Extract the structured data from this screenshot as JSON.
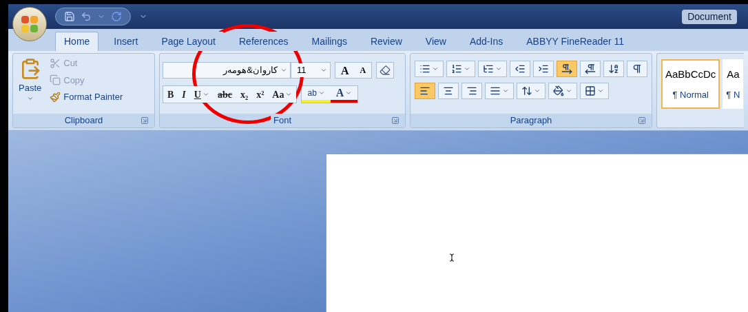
{
  "title_bar": {
    "title": "Document"
  },
  "tabs": [
    {
      "label": "Home",
      "selected": true
    },
    {
      "label": "Insert",
      "selected": false
    },
    {
      "label": "Page Layout",
      "selected": false
    },
    {
      "label": "References",
      "selected": false
    },
    {
      "label": "Mailings",
      "selected": false
    },
    {
      "label": "Review",
      "selected": false
    },
    {
      "label": "View",
      "selected": false
    },
    {
      "label": "Add-Ins",
      "selected": false
    },
    {
      "label": "ABBYY FineReader 11",
      "selected": false
    }
  ],
  "clipboard": {
    "label": "Clipboard",
    "paste": "Paste",
    "items": [
      {
        "kind": "cut",
        "label": "Cut",
        "disabled": true
      },
      {
        "kind": "copy",
        "label": "Copy",
        "disabled": true
      },
      {
        "kind": "painter",
        "label": "Format Painter",
        "disabled": false
      }
    ]
  },
  "font": {
    "label": "Font",
    "font_name": "كاروان&هومەر",
    "font_size": "11",
    "grow": "A",
    "shrink": "A",
    "format_buttons": [
      {
        "kind": "bold",
        "text": "B"
      },
      {
        "kind": "italic",
        "text": "I"
      },
      {
        "kind": "underline",
        "text": "U"
      },
      {
        "kind": "strike",
        "text": "abc"
      },
      {
        "kind": "sub",
        "text": "x₂"
      },
      {
        "kind": "sup",
        "text": "x²"
      },
      {
        "kind": "case",
        "text": "Aa"
      }
    ],
    "highlight": "ab",
    "font_color": "A"
  },
  "paragraph": {
    "label": "Paragraph",
    "row_1": [
      {
        "kind": "bullets"
      },
      {
        "kind": "numbering"
      },
      {
        "kind": "multilevel"
      },
      {
        "kind": "outdent"
      },
      {
        "kind": "indent"
      },
      {
        "kind": "ltr",
        "selected": true
      },
      {
        "kind": "rtl",
        "selected": false
      },
      {
        "kind": "sort"
      },
      {
        "kind": "marks"
      }
    ],
    "row_2": [
      {
        "kind": "align_left",
        "selected": true
      },
      {
        "kind": "align_center",
        "selected": false
      },
      {
        "kind": "align_right",
        "selected": false
      },
      {
        "kind": "justify",
        "selected": false
      },
      {
        "kind": "spacing"
      },
      {
        "kind": "shading"
      },
      {
        "kind": "borders"
      }
    ]
  },
  "styles": [
    {
      "preview": "AaBbCcDc",
      "name": "¶ Normal",
      "selected": true
    },
    {
      "preview": "Aa",
      "name": "¶ N",
      "selected": false
    }
  ],
  "annotation": {
    "kind": "ellipse"
  }
}
